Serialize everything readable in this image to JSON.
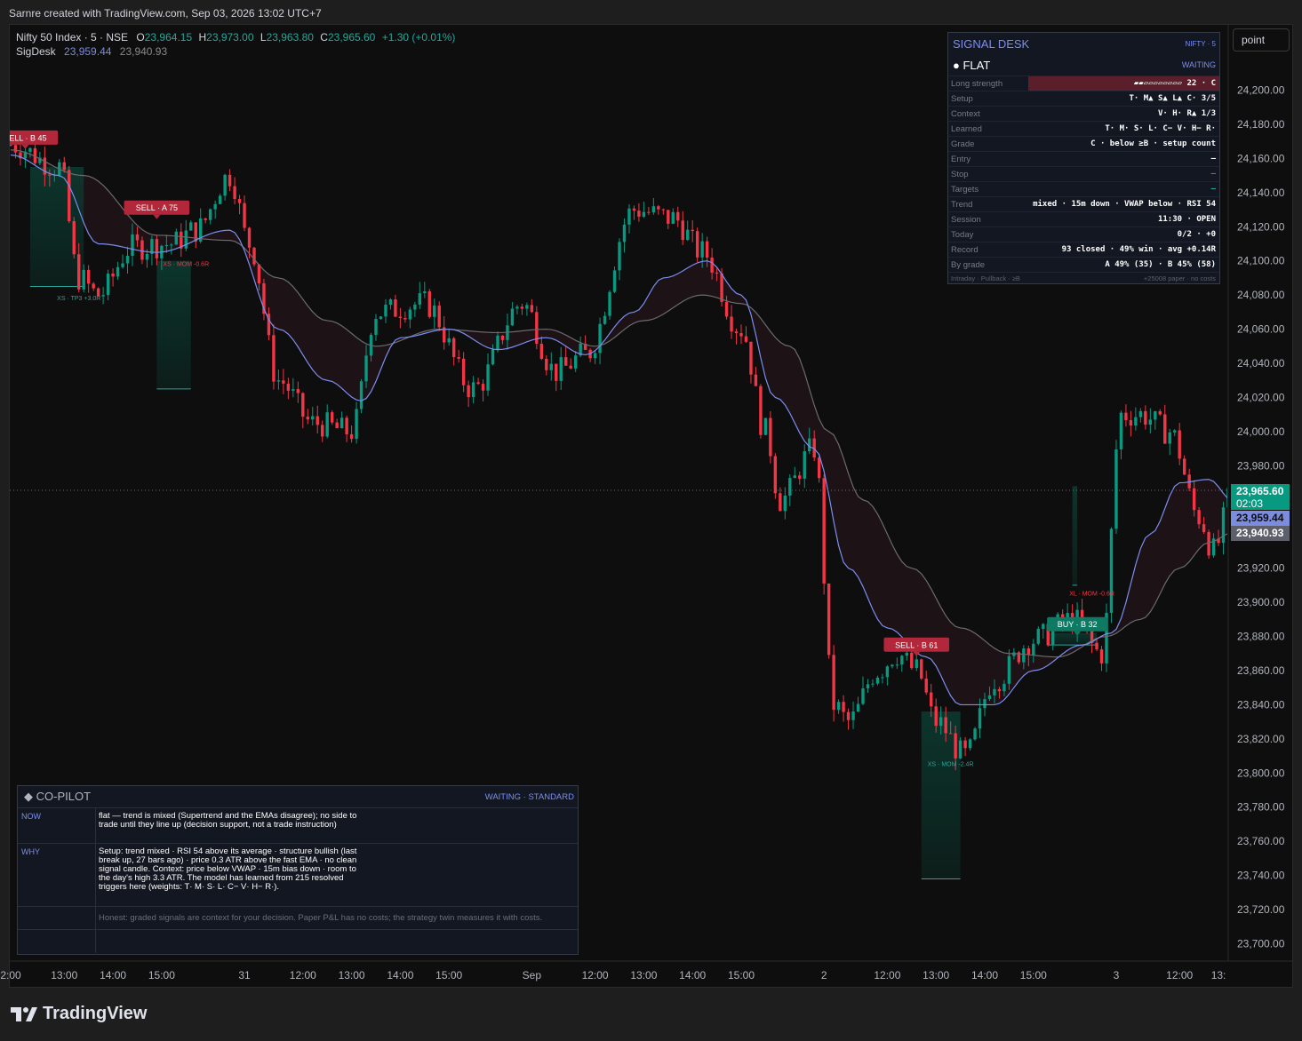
{
  "header": {
    "credit": "Sarnre created with TradingView.com, Sep 03, 2026 13:02 UTC+7"
  },
  "legend": {
    "symbol": "Nifty 50 Index · 5 · NSE",
    "o_label": "O",
    "o": "23,964.15",
    "h_label": "H",
    "h": "23,973.00",
    "l_label": "L",
    "l": "23,963.80",
    "c_label": "C",
    "c": "23,965.60",
    "change": "+1.30 (+0.01%)",
    "indicator": "SigDesk",
    "ind_v1": "23,959.44",
    "ind_v2": "23,940.93"
  },
  "price_axis": {
    "mode_button": "point",
    "last_price": "23,965.60",
    "countdown": "02:03",
    "fast_line": "23,959.44",
    "slow_line": "23,940.93"
  },
  "colors": {
    "up": "#089981",
    "down": "#f23645",
    "fast_ema": "#7b8ef0",
    "slow_ema": "#6b6b6b",
    "background": "#0e0e0e"
  },
  "signal_desk": {
    "title": "SIGNAL DESK",
    "symbol": "NIFTY · 5",
    "state": "● FLAT",
    "state_tag": "WAITING",
    "rows": [
      {
        "k": "Long strength",
        "v": "▰▰▱▱▱▱▱▱▱▱ 22 · C"
      },
      {
        "k": "Setup",
        "v": "T· M▲ S▲ L▲ C·  3/5"
      },
      {
        "k": "Context",
        "v": "V· H· R▲  1/3"
      },
      {
        "k": "Learned",
        "v": "T· M· S· L· C− V· H− R·"
      },
      {
        "k": "Grade",
        "v": "C · below ≥B · setup count"
      },
      {
        "k": "Entry",
        "v": "—"
      },
      {
        "k": "Stop",
        "v": "—"
      },
      {
        "k": "Targets",
        "v": "—"
      },
      {
        "k": "Trend",
        "v": "mixed · 15m down · VWAP below · RSI 54"
      },
      {
        "k": "Session",
        "v": "11:30 · OPEN"
      },
      {
        "k": "Today",
        "v": "0/2 · +0"
      },
      {
        "k": "Record",
        "v": "93 closed · 49% win · avg +0.14R"
      },
      {
        "k": "By grade",
        "v": "A 49% (35) · B 45% (58)"
      }
    ],
    "footer_left": "Intraday · Pullback · ≥B",
    "footer_right": "+25008 paper · no costs"
  },
  "copilot": {
    "title": "◆ CO-PILOT",
    "status": "WAITING · STANDARD",
    "now_label": "NOW",
    "now_text": "flat — trend is mixed (Supertrend and the EMAs disagree); no side to trade until they line up (decision support, not a trade instruction)",
    "why_label": "WHY",
    "why_text": "Setup: trend mixed · RSI 54 above its average · structure bullish (last break up, 27 bars ago) · price 0.3 ATR above the fast EMA · no clean signal candle. Context: price below VWAP · 15m bias down · room to the day's high 3.3 ATR. The model has learned from 215 resolved triggers here (weights: T· M· S· L· C− V· H− R·).",
    "note": "Honest: graded signals are context for your decision. Paper P&L has no costs; the strategy twin measures it with costs."
  },
  "chart_data": {
    "type": "candlestick",
    "symbol": "Nifty 50 Index",
    "interval": "5",
    "exchange": "NSE",
    "ylim": [
      23690,
      24225
    ],
    "y_ticks": [
      23700,
      23720,
      23740,
      23760,
      23780,
      23800,
      23820,
      23840,
      23860,
      23880,
      23900,
      23920,
      23940,
      23960,
      23980,
      24000,
      24020,
      24040,
      24060,
      24080,
      24100,
      24120,
      24140,
      24160,
      24180,
      24200
    ],
    "y_tick_labels": [
      "23,700.00",
      "23,720.00",
      "23,740.00",
      "23,760.00",
      "23,780.00",
      "23,800.00",
      "23,820.00",
      "23,840.00",
      "23,860.00",
      "23,880.00",
      "23,900.00",
      "23,920.00",
      "23,940.00",
      "23,960.00",
      "23,980.00",
      "24,000.00",
      "24,020.00",
      "24,040.00",
      "24,060.00",
      "24,080.00",
      "24,100.00",
      "24,120.00",
      "24,140.00",
      "24,160.00",
      "24,180.00",
      "24,200.00"
    ],
    "x_tick_labels": [
      {
        "label": "2:00",
        "bar": 0
      },
      {
        "label": "13:00",
        "bar": 11
      },
      {
        "label": "14:00",
        "bar": 21
      },
      {
        "label": "15:00",
        "bar": 31
      },
      {
        "label": "31",
        "bar": 48
      },
      {
        "label": "12:00",
        "bar": 60
      },
      {
        "label": "13:00",
        "bar": 70
      },
      {
        "label": "14:00",
        "bar": 80
      },
      {
        "label": "15:00",
        "bar": 90
      },
      {
        "label": "Sep",
        "bar": 107
      },
      {
        "label": "12:00",
        "bar": 120
      },
      {
        "label": "13:00",
        "bar": 130
      },
      {
        "label": "14:00",
        "bar": 140
      },
      {
        "label": "15:00",
        "bar": 150
      },
      {
        "label": "2",
        "bar": 167
      },
      {
        "label": "12:00",
        "bar": 180
      },
      {
        "label": "13:00",
        "bar": 190
      },
      {
        "label": "14:00",
        "bar": 200
      },
      {
        "label": "15:00",
        "bar": 210
      },
      {
        "label": "3",
        "bar": 227
      },
      {
        "label": "12:00",
        "bar": 240
      },
      {
        "label": "13:",
        "bar": 248
      }
    ],
    "close_path_anchors": [
      {
        "bar": 0,
        "price": 24168
      },
      {
        "bar": 10,
        "price": 24155
      },
      {
        "bar": 14,
        "price": 24090
      },
      {
        "bar": 18,
        "price": 24080
      },
      {
        "bar": 25,
        "price": 24108
      },
      {
        "bar": 33,
        "price": 24110
      },
      {
        "bar": 38,
        "price": 24118
      },
      {
        "bar": 45,
        "price": 24150
      },
      {
        "bar": 49,
        "price": 24110
      },
      {
        "bar": 55,
        "price": 24030
      },
      {
        "bar": 62,
        "price": 24005
      },
      {
        "bar": 70,
        "price": 24000
      },
      {
        "bar": 75,
        "price": 24070
      },
      {
        "bar": 85,
        "price": 24075
      },
      {
        "bar": 95,
        "price": 24025
      },
      {
        "bar": 105,
        "price": 24075
      },
      {
        "bar": 112,
        "price": 24035
      },
      {
        "bar": 118,
        "price": 24045
      },
      {
        "bar": 128,
        "price": 24130
      },
      {
        "bar": 136,
        "price": 24125
      },
      {
        "bar": 142,
        "price": 24105
      },
      {
        "bar": 150,
        "price": 24060
      },
      {
        "bar": 155,
        "price": 24000
      },
      {
        "bar": 158,
        "price": 23960
      },
      {
        "bar": 165,
        "price": 23990
      },
      {
        "bar": 169,
        "price": 23840
      },
      {
        "bar": 172,
        "price": 23830
      },
      {
        "bar": 178,
        "price": 23860
      },
      {
        "bar": 182,
        "price": 23870
      },
      {
        "bar": 186,
        "price": 23860
      },
      {
        "bar": 190,
        "price": 23830
      },
      {
        "bar": 196,
        "price": 23810
      },
      {
        "bar": 202,
        "price": 23855
      },
      {
        "bar": 210,
        "price": 23878
      },
      {
        "bar": 218,
        "price": 23890
      },
      {
        "bar": 224,
        "price": 23870
      },
      {
        "bar": 228,
        "price": 24010
      },
      {
        "bar": 232,
        "price": 24010
      },
      {
        "bar": 238,
        "price": 24000
      },
      {
        "bar": 244,
        "price": 23950
      },
      {
        "bar": 247,
        "price": 23930
      },
      {
        "bar": 251,
        "price": 23965.6
      }
    ],
    "fast_ema_anchors": [
      {
        "bar": 0,
        "price": 24162
      },
      {
        "bar": 10,
        "price": 24150
      },
      {
        "bar": 18,
        "price": 24110
      },
      {
        "bar": 30,
        "price": 24105
      },
      {
        "bar": 45,
        "price": 24118
      },
      {
        "bar": 55,
        "price": 24060
      },
      {
        "bar": 65,
        "price": 24030
      },
      {
        "bar": 72,
        "price": 24018
      },
      {
        "bar": 80,
        "price": 24055
      },
      {
        "bar": 90,
        "price": 24060
      },
      {
        "bar": 100,
        "price": 24048
      },
      {
        "bar": 110,
        "price": 24055
      },
      {
        "bar": 118,
        "price": 24045
      },
      {
        "bar": 128,
        "price": 24070
      },
      {
        "bar": 134,
        "price": 24090
      },
      {
        "bar": 143,
        "price": 24100
      },
      {
        "bar": 150,
        "price": 24080
      },
      {
        "bar": 157,
        "price": 24020
      },
      {
        "bar": 165,
        "price": 23990
      },
      {
        "bar": 172,
        "price": 23920
      },
      {
        "bar": 180,
        "price": 23885
      },
      {
        "bar": 188,
        "price": 23868
      },
      {
        "bar": 195,
        "price": 23840
      },
      {
        "bar": 202,
        "price": 23840
      },
      {
        "bar": 210,
        "price": 23860
      },
      {
        "bar": 220,
        "price": 23875
      },
      {
        "bar": 226,
        "price": 23882
      },
      {
        "bar": 234,
        "price": 23940
      },
      {
        "bar": 240,
        "price": 23970
      },
      {
        "bar": 246,
        "price": 23972
      },
      {
        "bar": 251,
        "price": 23959.44
      }
    ],
    "slow_ema_anchors": [
      {
        "bar": 0,
        "price": 24165
      },
      {
        "bar": 15,
        "price": 24150
      },
      {
        "bar": 30,
        "price": 24115
      },
      {
        "bar": 45,
        "price": 24112
      },
      {
        "bar": 55,
        "price": 24090
      },
      {
        "bar": 65,
        "price": 24065
      },
      {
        "bar": 75,
        "price": 24050
      },
      {
        "bar": 88,
        "price": 24060
      },
      {
        "bar": 100,
        "price": 24058
      },
      {
        "bar": 110,
        "price": 24060
      },
      {
        "bar": 120,
        "price": 24050
      },
      {
        "bar": 130,
        "price": 24065
      },
      {
        "bar": 142,
        "price": 24080
      },
      {
        "bar": 150,
        "price": 24075
      },
      {
        "bar": 160,
        "price": 24050
      },
      {
        "bar": 168,
        "price": 24000
      },
      {
        "bar": 175,
        "price": 23960
      },
      {
        "bar": 185,
        "price": 23920
      },
      {
        "bar": 195,
        "price": 23885
      },
      {
        "bar": 205,
        "price": 23870
      },
      {
        "bar": 215,
        "price": 23868
      },
      {
        "bar": 225,
        "price": 23880
      },
      {
        "bar": 232,
        "price": 23890
      },
      {
        "bar": 240,
        "price": 23920
      },
      {
        "bar": 246,
        "price": 23935
      },
      {
        "bar": 251,
        "price": 23940.93
      }
    ],
    "trade_zones": [
      {
        "from_bar": 4,
        "to_bar": 15,
        "entry": 24155,
        "target": 24085,
        "color": "up"
      },
      {
        "from_bar": 30,
        "to_bar": 37,
        "entry": 24100,
        "target": 24025,
        "color": "up"
      },
      {
        "from_bar": 187,
        "to_bar": 195,
        "entry": 23836,
        "target": 23738,
        "color": "up"
      },
      {
        "from_bar": 218,
        "to_bar": 219,
        "entry": 23968,
        "target": 23910,
        "color": "up"
      },
      {
        "from_bar": 213,
        "to_bar": 223,
        "entry": 23882,
        "target": 23875,
        "color": "up"
      }
    ],
    "signals": [
      {
        "label": "SELL · B 45",
        "bar": 3,
        "price": 24167,
        "side": "sell"
      },
      {
        "label": "SELL · A 75",
        "bar": 30,
        "price": 24126,
        "side": "sell"
      },
      {
        "label": "SELL · B 61",
        "bar": 186,
        "price": 23870,
        "side": "sell"
      },
      {
        "label": "BUY · B 32",
        "bar": 219,
        "price": 23882,
        "side": "buy"
      }
    ],
    "annotations": [
      {
        "label": "XS · TP3 +3.0R",
        "bar": 14,
        "price": 24077,
        "color": "up"
      },
      {
        "label": "XS · MOM -0.6R",
        "bar": 36,
        "price": 24097,
        "color": "down"
      },
      {
        "label": "XS · MOM -2.4R",
        "bar": 193,
        "price": 23804,
        "color": "up"
      },
      {
        "label": "XL · MOM -0.6R",
        "bar": 222,
        "price": 23904,
        "color": "down"
      }
    ],
    "last_price": 23965.6,
    "grid": false,
    "legend_position": "top-left"
  }
}
